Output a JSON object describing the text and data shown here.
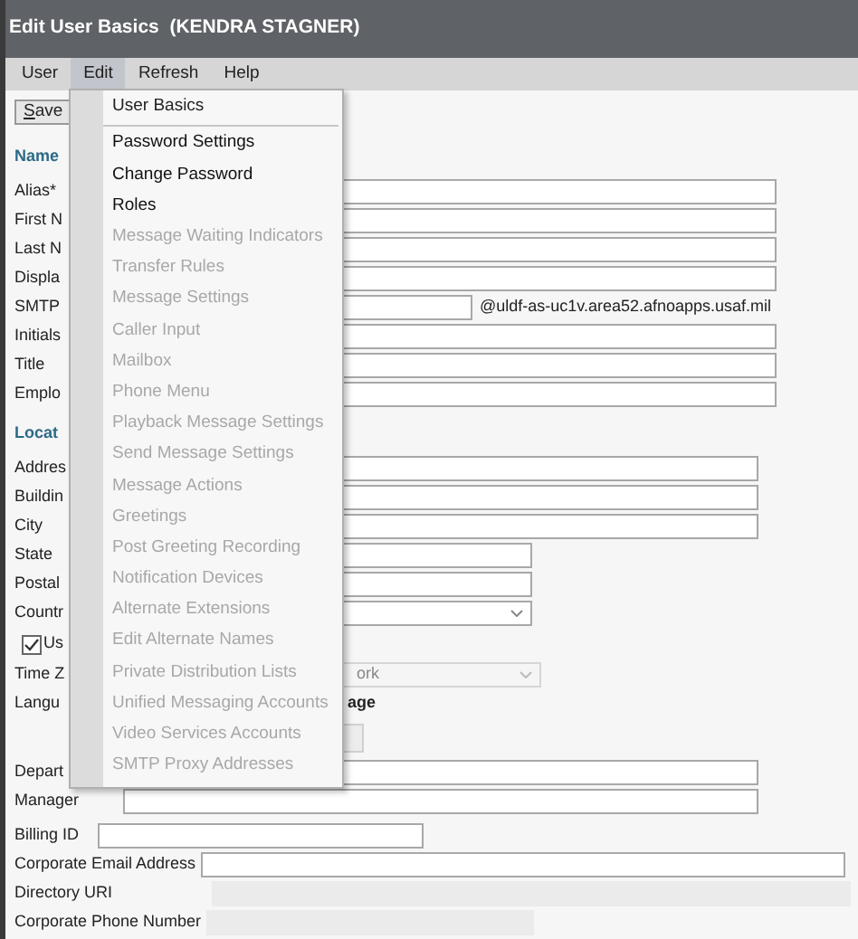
{
  "window": {
    "title": "Edit User Basics  (KENDRA STAGNER)"
  },
  "menu_bar": [
    {
      "label": "User",
      "selected": false
    },
    {
      "label": "Edit",
      "selected": true
    },
    {
      "label": "Refresh",
      "selected": false
    },
    {
      "label": "Help",
      "selected": false
    }
  ],
  "save_button": "Save",
  "sections": [
    {
      "heading": "Name",
      "rows": [
        {
          "label": "Alias*",
          "kind": "wide"
        },
        {
          "label": "First N",
          "kind": "wide"
        },
        {
          "label": "Last N",
          "kind": "wide"
        },
        {
          "label": "Displa",
          "kind": "wide"
        },
        {
          "label": "SMTP",
          "kind": "email",
          "suffix": "@uldf-as-uc1v.area52.afnoapps.usaf.mil"
        },
        {
          "label": "Initials",
          "kind": "wide"
        },
        {
          "label": "Title",
          "kind": "wide"
        },
        {
          "label": "Emplo",
          "kind": "wide"
        }
      ]
    },
    {
      "heading": "Locat",
      "rows": [
        {
          "label": "Addres",
          "kind": "medium"
        },
        {
          "label": "Buildin",
          "kind": "medium"
        },
        {
          "label": "City",
          "kind": "medium"
        },
        {
          "label": "State",
          "kind": "short"
        },
        {
          "label": "Postal",
          "kind": "short"
        },
        {
          "label": "Countr",
          "kind": "select"
        },
        {
          "label": "Us",
          "kind": "checkbox",
          "checked": true
        },
        {
          "label": "Time Z",
          "kind": "disabled_select",
          "value": "ork"
        },
        {
          "label": "Langu",
          "kind": "note",
          "text": "age"
        },
        {
          "kind": "button"
        },
        {
          "label": "Depart",
          "kind": "medium"
        },
        {
          "label": "Manager",
          "kind": "medium"
        }
      ]
    },
    {
      "rows": [
        {
          "label": "Billing ID",
          "kind": "billing"
        },
        {
          "label": "Corporate Email Address",
          "kind": "fill"
        },
        {
          "label": "Directory URI",
          "kind": "disabled_fill"
        },
        {
          "label": "Corporate Phone Number",
          "kind": "disabled_short"
        }
      ]
    }
  ],
  "dropdown": {
    "header": "User Basics",
    "items": [
      {
        "label": "Password Settings",
        "disabled": false
      },
      {
        "label": "Change Password",
        "disabled": false
      },
      {
        "label": "Roles",
        "disabled": false
      },
      {
        "label": "Message Waiting Indicators",
        "disabled": true
      },
      {
        "label": "Transfer Rules",
        "disabled": true
      },
      {
        "label": "Message Settings",
        "disabled": true
      },
      {
        "label": "Caller Input",
        "disabled": true
      },
      {
        "label": "Mailbox",
        "disabled": true
      },
      {
        "label": "Phone Menu",
        "disabled": true
      },
      {
        "label": "Playback Message Settings",
        "disabled": true
      },
      {
        "label": "Send Message Settings",
        "disabled": true
      },
      {
        "label": "Message Actions",
        "disabled": true
      },
      {
        "label": "Greetings",
        "disabled": true
      },
      {
        "label": "Post Greeting Recording",
        "disabled": true
      },
      {
        "label": "Notification Devices",
        "disabled": true
      },
      {
        "label": "Alternate Extensions",
        "disabled": true
      },
      {
        "label": "Edit Alternate Names",
        "disabled": true
      },
      {
        "label": "Private Distribution Lists",
        "disabled": true
      },
      {
        "label": "Unified Messaging Accounts",
        "disabled": true
      },
      {
        "label": "Video Services Accounts",
        "disabled": true
      },
      {
        "label": "SMTP Proxy Addresses",
        "disabled": true
      }
    ]
  }
}
